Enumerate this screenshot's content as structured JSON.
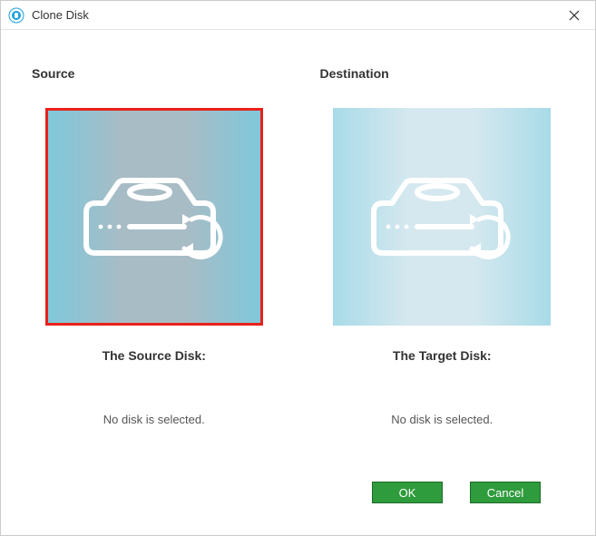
{
  "window": {
    "title": "Clone Disk"
  },
  "source": {
    "header": "Source",
    "label": "The Source Disk:",
    "status": "No disk is selected."
  },
  "destination": {
    "header": "Destination",
    "label": "The Target Disk:",
    "status": "No disk is selected."
  },
  "buttons": {
    "ok": "OK",
    "cancel": "Cancel"
  }
}
